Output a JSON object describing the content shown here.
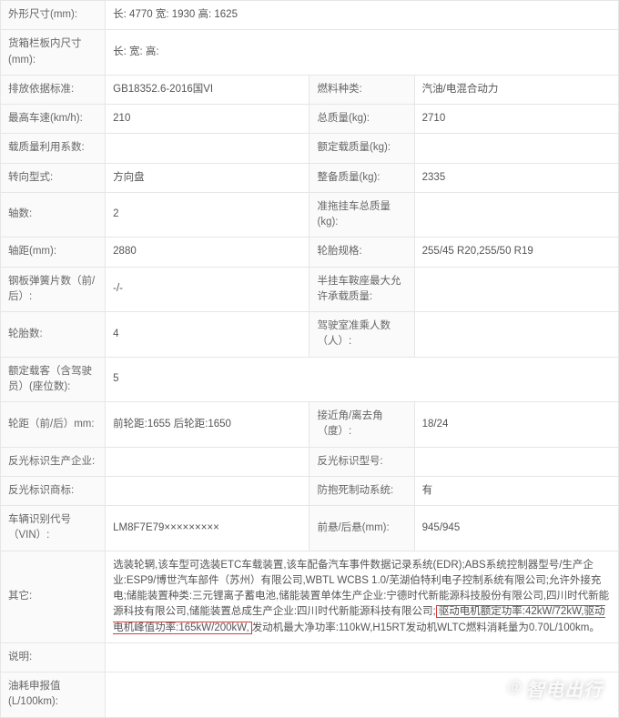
{
  "rows": [
    {
      "type": "pair",
      "l1": "外形尺寸(mm):",
      "v1": "长: 4770 宽: 1930 高: 1625",
      "span": 3
    },
    {
      "type": "pair",
      "l1": "货箱栏板内尺寸(mm):",
      "v1": "长:  宽:  高: ",
      "span": 3
    },
    {
      "type": "quad",
      "l1": "排放依据标准:",
      "v1": "GB18352.6-2016国VI",
      "l2": "燃料种类:",
      "v2": "汽油/电混合动力"
    },
    {
      "type": "quad",
      "l1": "最高车速(km/h):",
      "v1": "210",
      "l2": "总质量(kg):",
      "v2": "2710"
    },
    {
      "type": "quad",
      "l1": "载质量利用系数:",
      "v1": "",
      "l2": "额定载质量(kg):",
      "v2": ""
    },
    {
      "type": "quad",
      "l1": "转向型式:",
      "v1": "方向盘",
      "l2": "整备质量(kg):",
      "v2": "2335"
    },
    {
      "type": "quad",
      "l1": "轴数:",
      "v1": "2",
      "l2": "准拖挂车总质量(kg):",
      "v2": ""
    },
    {
      "type": "quad",
      "l1": "轴距(mm):",
      "v1": "2880",
      "l2": "轮胎规格:",
      "v2": "255/45 R20,255/50 R19"
    },
    {
      "type": "quad",
      "l1": "钢板弹簧片数（前/后）:",
      "v1": "-/-",
      "l2": "半挂车鞍座最大允许承载质量:",
      "v2": ""
    },
    {
      "type": "quad",
      "l1": "轮胎数:",
      "v1": "4",
      "l2": "驾驶室准乘人数（人）:",
      "v2": ""
    },
    {
      "type": "pair",
      "l1": "额定载客（含驾驶员）(座位数):",
      "v1": "5",
      "span": 3
    },
    {
      "type": "quad",
      "l1": "轮距（前/后）mm:",
      "v1": "前轮距:1655 后轮距:1650",
      "l2": "接近角/离去角（度）:",
      "v2": "18/24"
    },
    {
      "type": "quad",
      "l1": "反光标识生产企业:",
      "v1": "",
      "l2": "反光标识型号:",
      "v2": ""
    },
    {
      "type": "quad",
      "l1": "反光标识商标:",
      "v1": "",
      "l2": "防抱死制动系统:",
      "v2": "有"
    },
    {
      "type": "quad",
      "l1": "车辆识别代号（VIN）:",
      "v1": "LM8F7E79×××××××××",
      "l2": "前悬/后悬(mm):",
      "v2": "945/945"
    },
    {
      "type": "rich",
      "l1": "其它:",
      "pre": "选装轮辋,该车型可选装ETC车载装置,该车配备汽车事件数据记录系统(EDR);ABS系统控制器型号/生产企业:ESP9/博世汽车部件（苏州）有限公司,WBTL WCBS 1.0/芜湖伯特利电子控制系统有限公司;允许外接充电;储能装置种类:三元锂离子蓄电池,储能装置单体生产企业:宁德时代新能源科技股份有限公司,四川时代新能源科技有限公司,储能装置总成生产企业:四川时代新能源科技有限公司;",
      "hl": "驱动电机额定功率:42kW/72kW,驱动电机峰值功率:165kW/200kW,",
      "post": "发动机最大净功率:110kW,H15RT发动机WLTC燃料消耗量为0.70L/100km。"
    },
    {
      "type": "pair",
      "l1": "说明:",
      "v1": "",
      "span": 3
    },
    {
      "type": "pair",
      "l1": "油耗申报值(L/100km):",
      "v1": "",
      "span": 3
    }
  ],
  "watermark": {
    "at": "@",
    "text": "智电出行"
  }
}
